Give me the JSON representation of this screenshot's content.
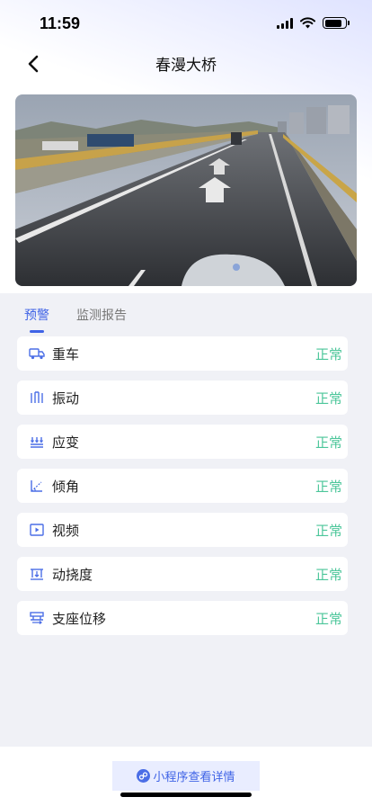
{
  "status_bar": {
    "time": "11:59",
    "icons": [
      "signal-icon",
      "wifi-icon",
      "battery-icon"
    ]
  },
  "nav": {
    "back_icon": "chevron-left-icon",
    "title": "春漫大桥"
  },
  "video": {
    "description_icon": "road-camera-feed"
  },
  "tabs": [
    {
      "label": "预警",
      "active": true
    },
    {
      "label": "监测报告",
      "active": false
    }
  ],
  "items": [
    {
      "icon": "truck-icon",
      "label": "重车",
      "status": "正常"
    },
    {
      "icon": "vibration-icon",
      "label": "振动",
      "status": "正常"
    },
    {
      "icon": "strain-icon",
      "label": "应变",
      "status": "正常"
    },
    {
      "icon": "tilt-icon",
      "label": "倾角",
      "status": "正常"
    },
    {
      "icon": "video-icon",
      "label": "视频",
      "status": "正常"
    },
    {
      "icon": "deflection-icon",
      "label": "动挠度",
      "status": "正常"
    },
    {
      "icon": "bearing-icon",
      "label": "支座位移",
      "status": "正常"
    }
  ],
  "footer": {
    "button_label": "小程序查看详情",
    "button_icon": "mini-program-icon"
  },
  "colors": {
    "accent": "#3f63e6",
    "status_ok": "#4cc69a",
    "background": "#f0f1f6"
  }
}
